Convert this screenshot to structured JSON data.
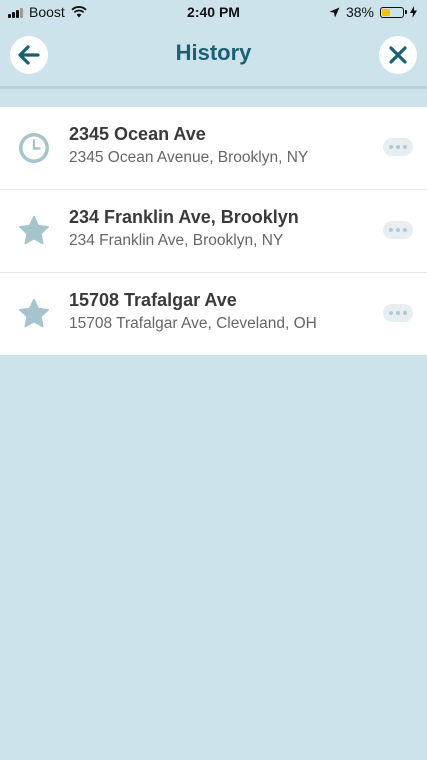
{
  "status_bar": {
    "carrier": "Boost",
    "time": "2:40 PM",
    "battery": "38%",
    "battery_level": 0.38
  },
  "header": {
    "title": "History",
    "back_icon": "arrow-left-icon",
    "close_icon": "close-icon"
  },
  "history": [
    {
      "icon": "clock-icon",
      "name": "2345 Ocean Ave",
      "address": "2345 Ocean Avenue, Brooklyn, NY"
    },
    {
      "icon": "star-icon",
      "name": "234 Franklin Ave, Brooklyn",
      "address": "234 Franklin Ave, Brooklyn, NY"
    },
    {
      "icon": "star-icon",
      "name": "15708 Trafalgar Ave",
      "address": "15708 Trafalgar Ave, Cleveland, OH"
    }
  ],
  "colors": {
    "background": "#cde3ec",
    "accent": "#1b5f72",
    "icon": "#a7c4cc"
  }
}
